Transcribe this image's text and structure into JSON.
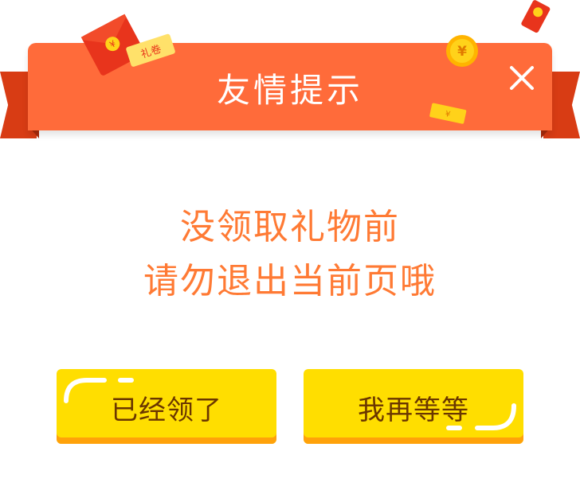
{
  "dialog": {
    "title": "友情提示",
    "close_icon": "close-icon",
    "message_lines": [
      "没领取礼物前",
      "请勿退出当前页哦"
    ],
    "buttons": {
      "confirm_label": "已经领了",
      "wait_label": "我再等等"
    },
    "decorations": {
      "red_envelope_text": "礼卷",
      "coin_symbol": "¥"
    }
  },
  "colors": {
    "header": "#ff6b3a",
    "ribbon": "#d83c14",
    "message_text": "#ff7a34",
    "button_fill": "#ffde00",
    "button_shadow": "#ffa20a",
    "button_text": "#6a3600"
  }
}
